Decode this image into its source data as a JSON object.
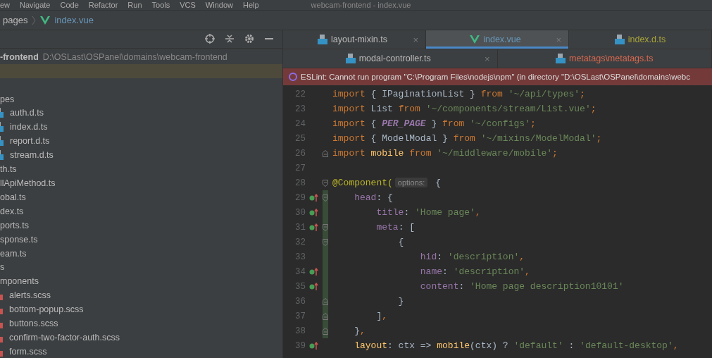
{
  "menu_bar": {
    "items": [
      "ew",
      "Navigate",
      "Code",
      "Refactor",
      "Run",
      "Tools",
      "VCS",
      "Window",
      "Help"
    ],
    "title": "webcam-frontend - index.vue"
  },
  "breadcrumb": [
    {
      "label": "pages"
    },
    {
      "label": "index.vue",
      "kind": "vue"
    }
  ],
  "project_panel": {
    "root": {
      "name": "-frontend",
      "path": "D:\\OSLast\\OSPanel\\domains\\webcam-frontend"
    },
    "highlighted_row": true,
    "tree": [
      {
        "label": "pes",
        "children": [
          {
            "label": "auth.d.ts",
            "kind": "ts"
          },
          {
            "label": "index.d.ts",
            "kind": "ts"
          },
          {
            "label": "report.d.ts",
            "kind": "ts"
          },
          {
            "label": "stream.d.ts",
            "kind": "ts"
          }
        ]
      },
      {
        "label": "th.ts"
      },
      {
        "label": "llApiMethod.ts"
      },
      {
        "label": "obal.ts"
      },
      {
        "label": "dex.ts"
      },
      {
        "label": "ports.ts"
      },
      {
        "label": "sponse.ts"
      },
      {
        "label": "eam.ts"
      },
      {
        "label": "s"
      },
      {
        "label": "mponents",
        "children": [
          {
            "label": "alerts.scss",
            "kind": "scss"
          },
          {
            "label": "bottom-popup.scss",
            "kind": "scss"
          },
          {
            "label": "buttons.scss",
            "kind": "scss"
          },
          {
            "label": "confirm-two-factor-auth.scss",
            "kind": "scss"
          },
          {
            "label": "form.scss",
            "kind": "scss"
          }
        ]
      }
    ]
  },
  "tab_rows": [
    [
      {
        "label": "layout-mixin.ts",
        "kind": "ts",
        "selected": false,
        "color": "#bbbbbb",
        "close": "×"
      },
      {
        "label": "index.vue",
        "kind": "vue",
        "selected": true,
        "color": "#6897bb",
        "close": "×"
      },
      {
        "label": "index.d.ts",
        "kind": "ts",
        "selected": false,
        "color": "#a8a43a"
      }
    ],
    [
      {
        "label": "modal-controller.ts",
        "kind": "ts",
        "selected": false,
        "color": "#bbbbbb",
        "close": "×"
      },
      {
        "label": "metatags\\metatags.ts",
        "kind": "ts",
        "selected": false,
        "color": "#d9684f"
      }
    ]
  ],
  "error_banner": "ESLint: Cannot run program \"C:\\Program Files\\nodejs\\npm\" (in directory \"D:\\OSLast\\OSPanel\\domains\\webc",
  "code": [
    {
      "n": "22",
      "mark": false,
      "kind": "line",
      "changed": false,
      "tokens": [
        {
          "kind": "kw",
          "t": "import"
        },
        {
          "kind": "plain",
          "t": " { IPaginationList } "
        },
        {
          "kind": "kw",
          "t": "from"
        },
        {
          "kind": "str",
          "t": " '~/api/types'"
        },
        {
          "kind": "kw",
          "t": ";"
        }
      ]
    },
    {
      "n": "23",
      "mark": false,
      "kind": "line",
      "changed": false,
      "tokens": [
        {
          "kind": "kw",
          "t": "import"
        },
        {
          "kind": "plain",
          "t": " List "
        },
        {
          "kind": "kw",
          "t": "from"
        },
        {
          "kind": "str",
          "t": " '~/components/stream/List.vue'"
        },
        {
          "kind": "kw",
          "t": ";"
        }
      ]
    },
    {
      "n": "24",
      "mark": false,
      "kind": "line",
      "changed": false,
      "tokens": [
        {
          "kind": "kw",
          "t": "import"
        },
        {
          "kind": "plain",
          "t": " { "
        },
        {
          "kind": "const",
          "t": "PER_PAGE"
        },
        {
          "kind": "plain",
          "t": " } "
        },
        {
          "kind": "kw",
          "t": "from"
        },
        {
          "kind": "str",
          "t": " '~/configs'"
        },
        {
          "kind": "kw",
          "t": ";"
        }
      ]
    },
    {
      "n": "25",
      "mark": false,
      "kind": "line",
      "changed": false,
      "tokens": [
        {
          "kind": "kw",
          "t": "import"
        },
        {
          "kind": "plain",
          "t": " { ModelModal } "
        },
        {
          "kind": "kw",
          "t": "from"
        },
        {
          "kind": "str",
          "t": " '~/mixins/ModelModal'"
        },
        {
          "kind": "kw",
          "t": ";"
        }
      ]
    },
    {
      "n": "26",
      "mark": false,
      "kind": "fold_end",
      "changed": false,
      "tokens": [
        {
          "kind": "kw",
          "t": "import"
        },
        {
          "kind": "func",
          "t": " mobile "
        },
        {
          "kind": "kw",
          "t": "from"
        },
        {
          "kind": "str",
          "t": " '~/middleware/mobile'"
        },
        {
          "kind": "kw",
          "t": ";"
        }
      ]
    },
    {
      "n": "27",
      "mark": false,
      "kind": "line",
      "changed": false
    },
    {
      "n": "28",
      "mark": false,
      "kind": "fold_start",
      "changed": false,
      "tokens": [
        {
          "kind": "deco",
          "t": "@Component("
        },
        {
          "kind": "hint",
          "t": "options:"
        },
        {
          "kind": "plain",
          "t": " {"
        }
      ]
    },
    {
      "n": "29",
      "mark": true,
      "kind": "fold_start",
      "changed": true,
      "tokens": [
        {
          "kind": "prop",
          "t": "    head"
        },
        {
          "kind": "plain",
          "t": ": {"
        }
      ]
    },
    {
      "n": "30",
      "mark": true,
      "kind": "line",
      "changed": true,
      "tokens": [
        {
          "kind": "prop",
          "t": "        title"
        },
        {
          "kind": "plain",
          "t": ": "
        },
        {
          "kind": "str",
          "t": "'Home page'"
        },
        {
          "kind": "kw",
          "t": ","
        }
      ]
    },
    {
      "n": "31",
      "mark": true,
      "kind": "fold_start",
      "changed": true,
      "tokens": [
        {
          "kind": "prop",
          "t": "        meta"
        },
        {
          "kind": "plain",
          "t": ": ["
        }
      ]
    },
    {
      "n": "32",
      "mark": false,
      "kind": "fold_start",
      "changed": true,
      "tokens": [
        {
          "kind": "plain",
          "t": "            {"
        }
      ]
    },
    {
      "n": "33",
      "mark": false,
      "kind": "line",
      "changed": true,
      "tokens": [
        {
          "kind": "prop",
          "t": "                hid"
        },
        {
          "kind": "plain",
          "t": ": "
        },
        {
          "kind": "str",
          "t": "'description'"
        },
        {
          "kind": "kw",
          "t": ","
        }
      ]
    },
    {
      "n": "34",
      "mark": true,
      "kind": "line",
      "changed": true,
      "tokens": [
        {
          "kind": "prop",
          "t": "                name"
        },
        {
          "kind": "plain",
          "t": ": "
        },
        {
          "kind": "str",
          "t": "'description'"
        },
        {
          "kind": "kw",
          "t": ","
        }
      ]
    },
    {
      "n": "35",
      "mark": true,
      "kind": "line",
      "changed": true,
      "tokens": [
        {
          "kind": "prop",
          "t": "                content"
        },
        {
          "kind": "plain",
          "t": ": "
        },
        {
          "kind": "str",
          "t": "'Home page description10101'"
        }
      ]
    },
    {
      "n": "36",
      "mark": false,
      "kind": "fold_end",
      "changed": true,
      "tokens": [
        {
          "kind": "plain",
          "t": "            }"
        }
      ]
    },
    {
      "n": "37",
      "mark": false,
      "kind": "fold_end",
      "changed": true,
      "tokens": [
        {
          "kind": "plain",
          "t": "        ]"
        },
        {
          "kind": "kw",
          "t": ","
        }
      ]
    },
    {
      "n": "38",
      "mark": false,
      "kind": "fold_end",
      "changed": true,
      "tokens": [
        {
          "kind": "plain",
          "t": "    }"
        },
        {
          "kind": "kw",
          "t": ","
        }
      ]
    },
    {
      "n": "39",
      "mark": true,
      "kind": "line",
      "changed": false,
      "tokens": [
        {
          "kind": "func",
          "t": "    layout"
        },
        {
          "kind": "plain",
          "t": ": ctx => "
        },
        {
          "kind": "func",
          "t": "mobile"
        },
        {
          "kind": "plain",
          "t": "(ctx) ? "
        },
        {
          "kind": "str",
          "t": "'default'"
        },
        {
          "kind": "plain",
          "t": " : "
        },
        {
          "kind": "str",
          "t": "'default-desktop'"
        },
        {
          "kind": "kw",
          "t": ","
        }
      ]
    }
  ]
}
